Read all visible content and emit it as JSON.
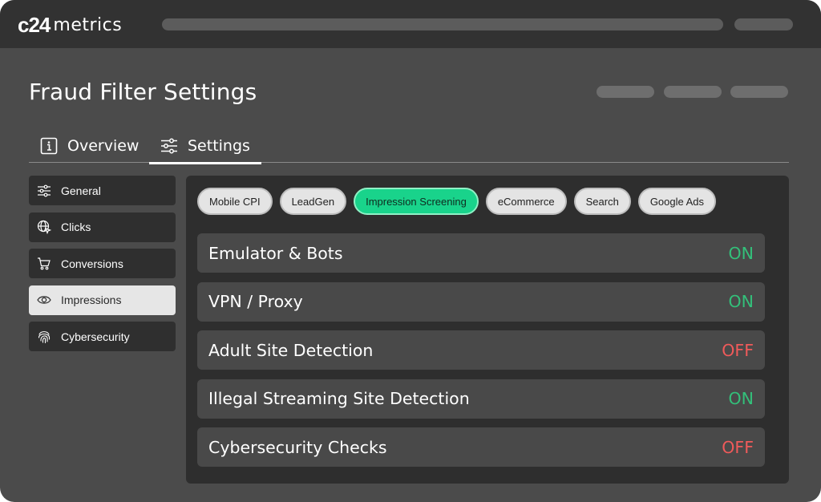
{
  "app": {
    "logo_mark": "c24",
    "logo_text": "metrics"
  },
  "page": {
    "title": "Fraud Filter Settings"
  },
  "tabs": [
    {
      "label": "Overview",
      "icon": "info-icon",
      "active": false
    },
    {
      "label": "Settings",
      "icon": "sliders-icon",
      "active": true
    }
  ],
  "sidebar": {
    "items": [
      {
        "label": "General",
        "icon": "sliders-icon",
        "active": false
      },
      {
        "label": "Clicks",
        "icon": "globe-cursor-icon",
        "active": false
      },
      {
        "label": "Conversions",
        "icon": "cart-icon",
        "active": false
      },
      {
        "label": "Impressions",
        "icon": "eye-icon",
        "active": true
      },
      {
        "label": "Cybersecurity",
        "icon": "fingerprint-icon",
        "active": false
      }
    ]
  },
  "chips": [
    {
      "label": "Mobile CPI",
      "active": false
    },
    {
      "label": "LeadGen",
      "active": false
    },
    {
      "label": "Impression Screening",
      "active": true
    },
    {
      "label": "eCommerce",
      "active": false
    },
    {
      "label": "Search",
      "active": false
    },
    {
      "label": "Google Ads",
      "active": false
    }
  ],
  "filters": [
    {
      "label": "Emulator & Bots",
      "status": "ON"
    },
    {
      "label": "VPN / Proxy",
      "status": "ON"
    },
    {
      "label": "Adult Site Detection",
      "status": "OFF"
    },
    {
      "label": "Illegal Streaming Site Detection",
      "status": "ON"
    },
    {
      "label": "Cybersecurity Checks",
      "status": "OFF"
    }
  ],
  "colors": {
    "on": "#33c07a",
    "off": "#f05a5a",
    "accent": "#19d38b"
  }
}
